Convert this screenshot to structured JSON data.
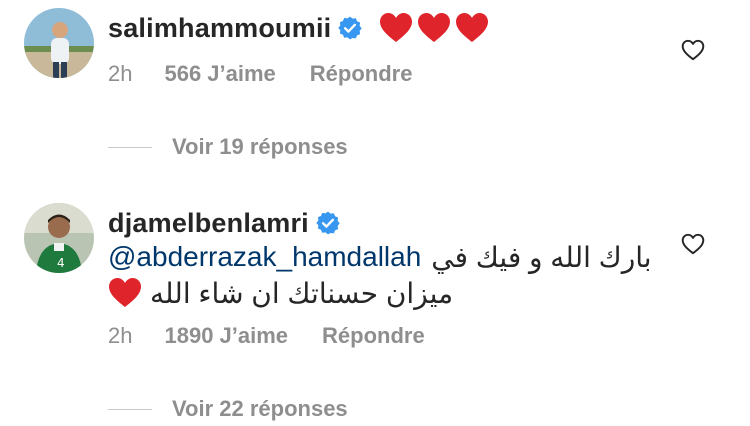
{
  "comments": [
    {
      "username": "salimhammoumii",
      "verified": true,
      "text": "",
      "hearts": 3,
      "time": "2h",
      "likes": "566 J’aime",
      "reply_label": "Répondre",
      "view_replies": "Voir 19 réponses"
    },
    {
      "username": "djamelbenlamri",
      "verified": true,
      "mention": "@abderrazak_hamdallah",
      "text_line1": "بارك الله و فيك في",
      "text_line2": "ميزان حسناتك ان شاء الله",
      "hearts": 1,
      "time": "2h",
      "likes": "1890 J’aime",
      "reply_label": "Répondre",
      "view_replies": "Voir 22 réponses"
    }
  ],
  "colors": {
    "text": "#262626",
    "muted": "#8e8e8e",
    "mention": "#00376b",
    "verified": "#3897f0",
    "heart": "#e0242b"
  },
  "icons": {
    "verified": "verified-badge-icon",
    "like": "heart-outline-icon",
    "emoji": "red-heart-emoji"
  }
}
